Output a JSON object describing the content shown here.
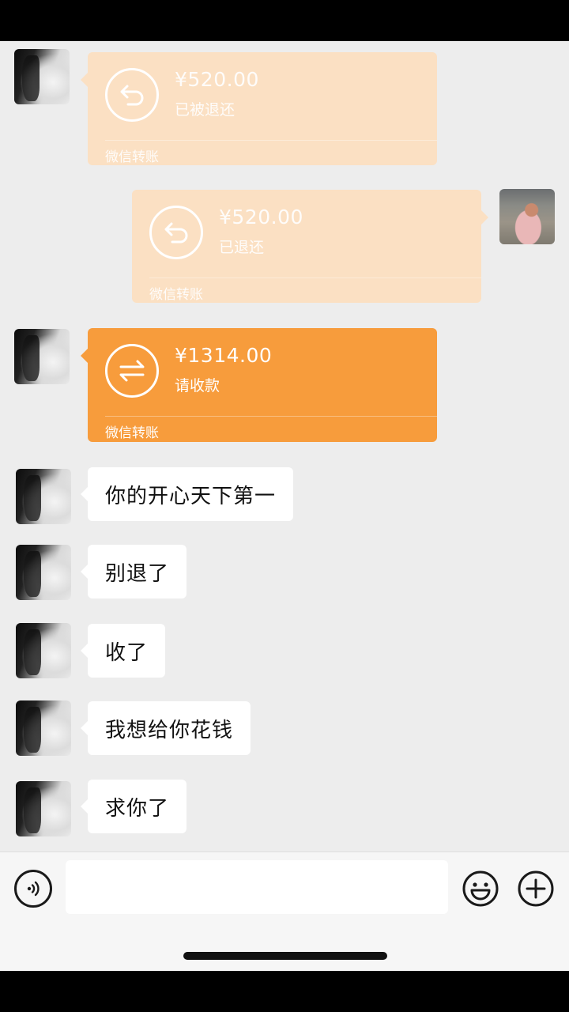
{
  "messages": {
    "transfer_refunded_by_them": {
      "amount": "¥520.00",
      "status": "已被退还",
      "label": "微信转账"
    },
    "transfer_refunded_by_me": {
      "amount": "¥520.00",
      "status": "已退还",
      "label": "微信转账"
    },
    "transfer_pending": {
      "amount": "¥1314.00",
      "status": "请收款",
      "label": "微信转账"
    },
    "texts": [
      "你的开心天下第一",
      "别退了",
      "收了",
      "我想给你花钱",
      "求你了"
    ]
  },
  "input": {
    "placeholder": ""
  },
  "icons": {
    "refund": "refund-arrow-icon",
    "transfer": "transfer-arrows-icon",
    "voice": "voice-icon",
    "emoji": "emoji-icon",
    "plus": "plus-icon"
  },
  "colors": {
    "transfer_active": "#f79c3c",
    "transfer_faded": "#fbe0c3",
    "chat_background": "#ededed"
  }
}
